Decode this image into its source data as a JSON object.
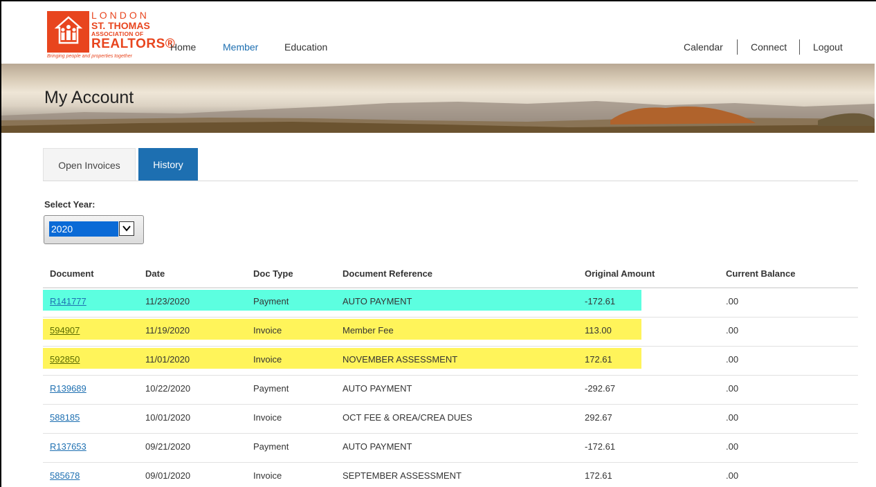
{
  "logo": {
    "line1": "LONDON",
    "line2": "ST. THOMAS",
    "line3": "ASSOCIATION OF",
    "line4": "REALTORS®",
    "tagline": "Bringing people and properties together",
    "brand_color": "#e8451e"
  },
  "nav": {
    "home": "Home",
    "member": "Member",
    "education": "Education",
    "calendar": "Calendar",
    "connect": "Connect",
    "logout": "Logout",
    "active_color": "#1d6fb1"
  },
  "banner": {
    "title": "My Account"
  },
  "tabs": [
    {
      "label": "Open Invoices",
      "active": false
    },
    {
      "label": "History",
      "active": true
    }
  ],
  "year_filter": {
    "label": "Select Year:",
    "value": "2020"
  },
  "table": {
    "headers": [
      "Document",
      "Date",
      "Doc Type",
      "Document Reference",
      "Original Amount",
      "Current Balance"
    ],
    "rows": [
      {
        "document": "R141777",
        "date": "11/23/2020",
        "doc_type": "Payment",
        "reference": "AUTO PAYMENT",
        "original_amount": "-172.61",
        "current_balance": ".00",
        "highlight": "#5cffe0"
      },
      {
        "document": "594907",
        "date": "11/19/2020",
        "doc_type": "Invoice",
        "reference": "Member Fee",
        "original_amount": "113.00",
        "current_balance": ".00",
        "highlight": "#fff45a"
      },
      {
        "document": "592850",
        "date": "11/01/2020",
        "doc_type": "Invoice",
        "reference": "NOVEMBER ASSESSMENT",
        "original_amount": "172.61",
        "current_balance": ".00",
        "highlight": "#fff45a"
      },
      {
        "document": "R139689",
        "date": "10/22/2020",
        "doc_type": "Payment",
        "reference": "AUTO PAYMENT",
        "original_amount": "-292.67",
        "current_balance": ".00",
        "highlight": ""
      },
      {
        "document": "588185",
        "date": "10/01/2020",
        "doc_type": "Invoice",
        "reference": "OCT FEE & OREA/CREA DUES",
        "original_amount": "292.67",
        "current_balance": ".00",
        "highlight": ""
      },
      {
        "document": "R137653",
        "date": "09/21/2020",
        "doc_type": "Payment",
        "reference": "AUTO PAYMENT",
        "original_amount": "-172.61",
        "current_balance": ".00",
        "highlight": ""
      },
      {
        "document": "585678",
        "date": "09/01/2020",
        "doc_type": "Invoice",
        "reference": "SEPTEMBER ASSESSMENT",
        "original_amount": "172.61",
        "current_balance": ".00",
        "highlight": ""
      }
    ]
  }
}
